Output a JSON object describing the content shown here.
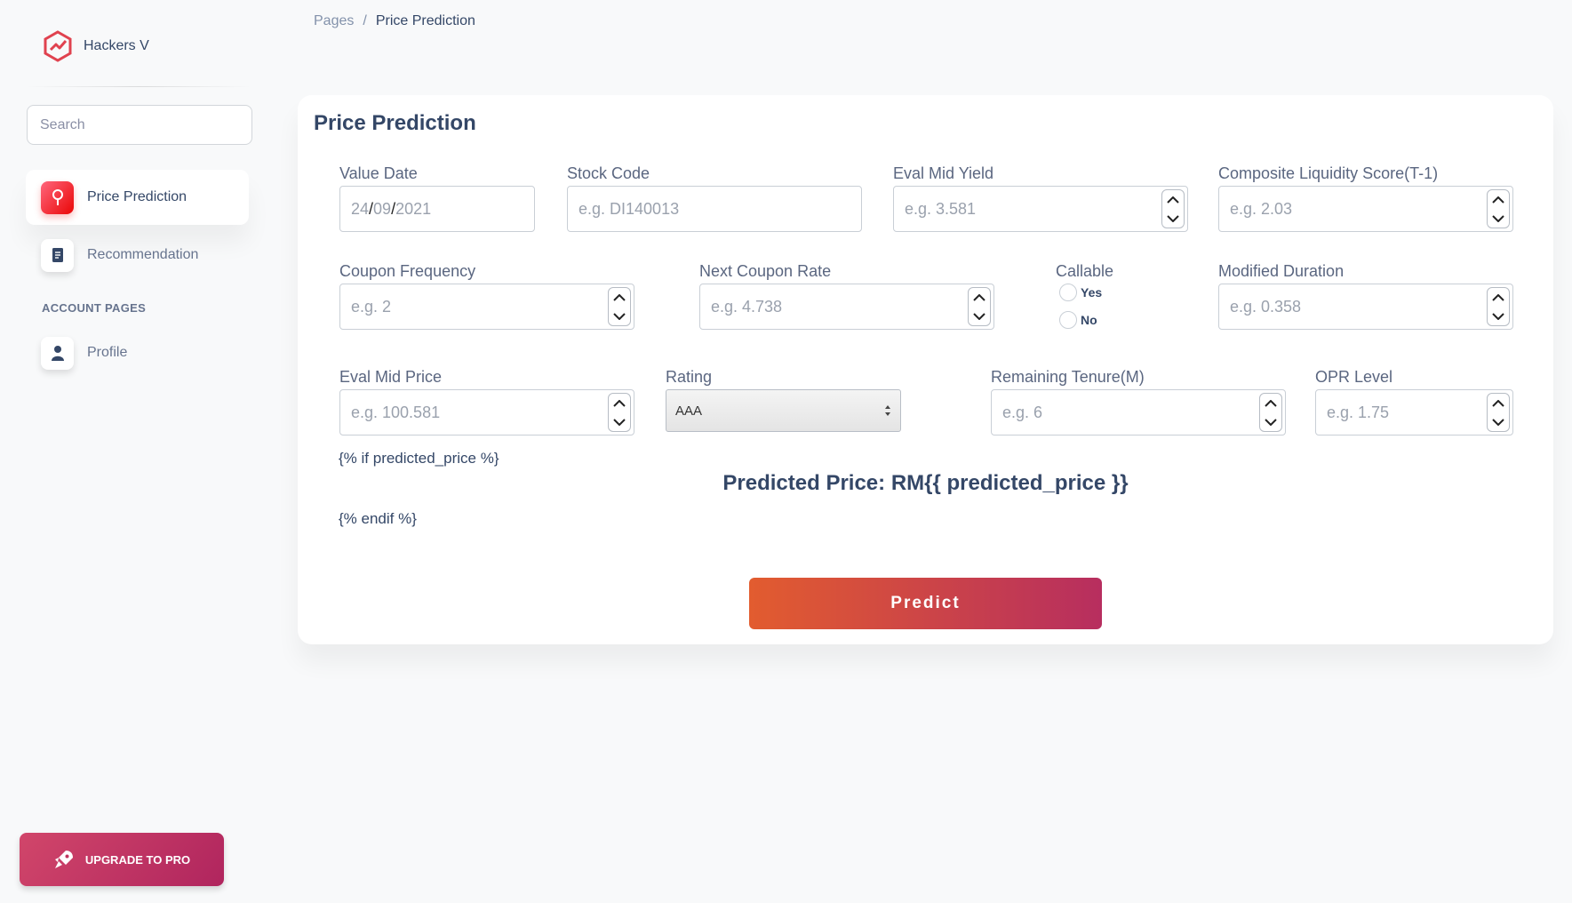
{
  "brand": {
    "name": "Hackers V"
  },
  "breadcrumb": {
    "parent": "Pages",
    "separator": "/",
    "current": "Price Prediction"
  },
  "sidebar": {
    "search_placeholder": "Search",
    "items": [
      {
        "label": "Price Prediction",
        "icon": "map-pin-icon",
        "active": true
      },
      {
        "label": "Recommendation",
        "icon": "clipboard-icon",
        "active": false
      }
    ],
    "section_title": "ACCOUNT PAGES",
    "account_items": [
      {
        "label": "Profile",
        "icon": "user-icon"
      }
    ],
    "upgrade_label": "UPGRADE TO PRO"
  },
  "form": {
    "title": "Price Prediction",
    "value_date": {
      "label": "Value Date",
      "dd": "24",
      "mm": "09",
      "yyyy": "2021"
    },
    "stock_code": {
      "label": "Stock Code",
      "placeholder": "e.g. DI140013"
    },
    "eval_mid_yield": {
      "label": "Eval Mid Yield",
      "placeholder": "e.g. 3.581"
    },
    "composite_liquidity": {
      "label": "Composite Liquidity Score(T-1)",
      "placeholder": "e.g. 2.03"
    },
    "coupon_frequency": {
      "label": "Coupon Frequency",
      "placeholder": "e.g. 2"
    },
    "next_coupon_rate": {
      "label": "Next Coupon Rate",
      "placeholder": "e.g. 4.738"
    },
    "callable": {
      "label": "Callable",
      "options": [
        "Yes",
        "No"
      ]
    },
    "modified_duration": {
      "label": "Modified Duration",
      "placeholder": "e.g. 0.358"
    },
    "eval_mid_price": {
      "label": "Eval Mid Price",
      "placeholder": "e.g. 100.581"
    },
    "rating": {
      "label": "Rating",
      "selected": "AAA"
    },
    "remaining_tenure": {
      "label": "Remaining Tenure(M)",
      "placeholder": "e.g. 6"
    },
    "opr_level": {
      "label": "OPR Level",
      "placeholder": "e.g. 1.75"
    },
    "template_if": "{% if predicted_price %}",
    "predicted_text": "Predicted Price: RM{{ predicted_price }}",
    "template_endif": "{% endif %}",
    "predict_label": "Predict"
  },
  "colors": {
    "accent_start": "#e25c2f",
    "accent_end": "#b72e5f",
    "text": "#344767"
  }
}
